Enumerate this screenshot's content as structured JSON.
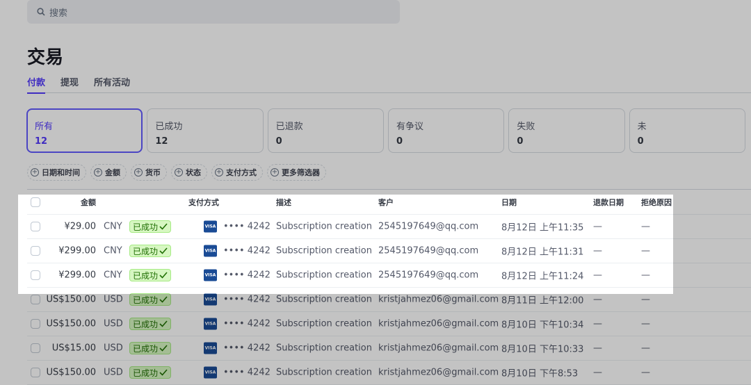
{
  "search": {
    "placeholder": "搜索"
  },
  "page_title": "交易",
  "tabs": [
    {
      "label": "付款"
    },
    {
      "label": "提现"
    },
    {
      "label": "所有活动"
    }
  ],
  "cards": [
    {
      "label": "所有",
      "count": "12"
    },
    {
      "label": "已成功",
      "count": "12"
    },
    {
      "label": "已退款",
      "count": "0"
    },
    {
      "label": "有争议",
      "count": "0"
    },
    {
      "label": "失败",
      "count": "0"
    },
    {
      "label": "未",
      "count": "0"
    }
  ],
  "filters": [
    "日期和时间",
    "金额",
    "货币",
    "状态",
    "支付方式",
    "更多筛选器"
  ],
  "columns": {
    "amount": "金额",
    "payment_method": "支付方式",
    "description": "描述",
    "customer": "客户",
    "date": "日期",
    "refund_date": "退款日期",
    "decline_reason": "拒绝原因"
  },
  "rows": [
    {
      "amount": "¥29.00",
      "currency": "CNY",
      "status": "已成功",
      "card": "•••• 4242",
      "description": "Subscription creation",
      "customer": "2545197649@qq.com",
      "date": "8月12日 上午11:35",
      "refund_date": "—",
      "decline_reason": "—"
    },
    {
      "amount": "¥299.00",
      "currency": "CNY",
      "status": "已成功",
      "card": "•••• 4242",
      "description": "Subscription creation",
      "customer": "2545197649@qq.com",
      "date": "8月12日 上午11:31",
      "refund_date": "—",
      "decline_reason": "—"
    },
    {
      "amount": "¥299.00",
      "currency": "CNY",
      "status": "已成功",
      "card": "•••• 4242",
      "description": "Subscription creation",
      "customer": "2545197649@qq.com",
      "date": "8月12日 上午11:24",
      "refund_date": "—",
      "decline_reason": "—"
    },
    {
      "amount": "US$150.00",
      "currency": "USD",
      "status": "已成功",
      "card": "•••• 4242",
      "description": "Subscription creation",
      "customer": "kristjahmez06@gmail.com",
      "date": "8月11日 上午12:00",
      "refund_date": "—",
      "decline_reason": "—"
    },
    {
      "amount": "US$150.00",
      "currency": "USD",
      "status": "已成功",
      "card": "•••• 4242",
      "description": "Subscription creation",
      "customer": "kristjahmez06@gmail.com",
      "date": "8月10日 下午10:34",
      "refund_date": "—",
      "decline_reason": "—"
    },
    {
      "amount": "US$15.00",
      "currency": "USD",
      "status": "已成功",
      "card": "•••• 4242",
      "description": "Subscription creation",
      "customer": "kristjahmez06@gmail.com",
      "date": "8月10日 下午10:33",
      "refund_date": "—",
      "decline_reason": "—"
    },
    {
      "amount": "US$150.00",
      "currency": "USD",
      "status": "已成功",
      "card": "•••• 4242",
      "description": "Subscription creation",
      "customer": "kristjahmez06@gmail.com",
      "date": "8月10日 下午8:53",
      "refund_date": "—",
      "decline_reason": "—"
    }
  ],
  "card_brand": "VISA",
  "colors": {
    "accent": "#533afd",
    "success_bg": "#d7f7c2",
    "success_text": "#217005",
    "visa": "#1a4b95"
  }
}
